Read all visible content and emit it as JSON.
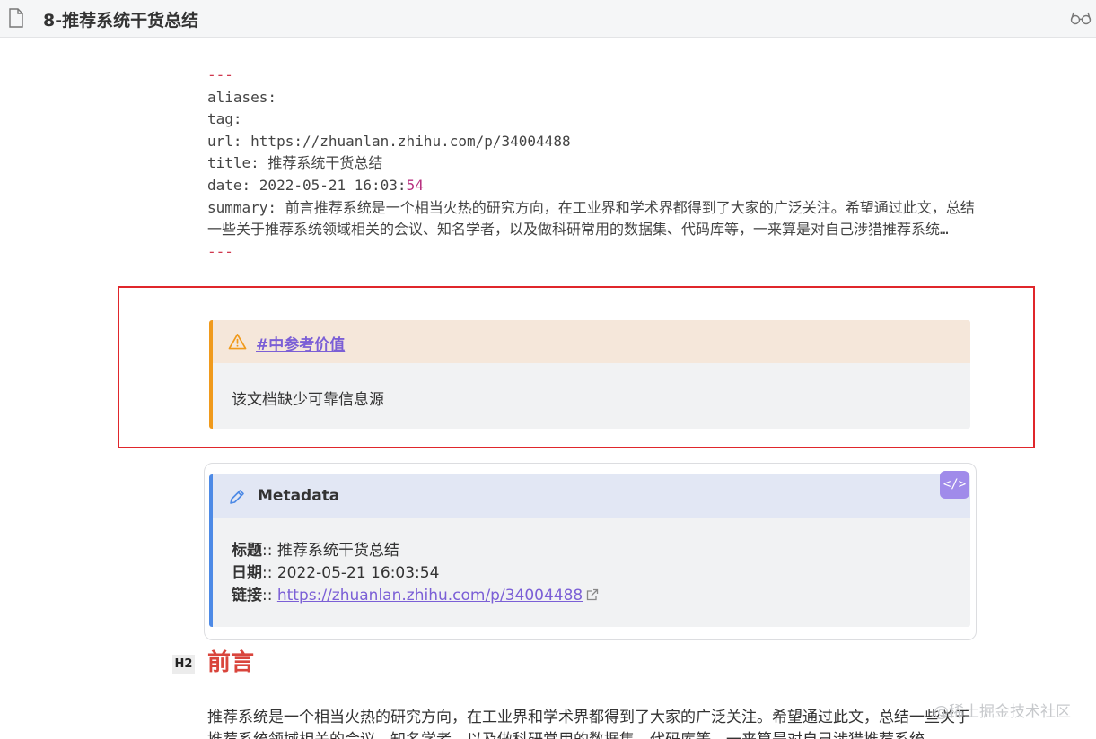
{
  "header": {
    "title": "8-推荐系统干货总结",
    "file_icon": "file-icon",
    "reading_icon": "glasses-icon"
  },
  "frontmatter": {
    "open_delimiter": "---",
    "aliases_line": "aliases:",
    "tag_line": "tag:",
    "url_line": "url: https://zhuanlan.zhihu.com/p/34004488",
    "title_line": "title: 推荐系统干货总结",
    "date_prefix": "date: 2022-05-21 16:03:",
    "date_seconds": "54",
    "summary_line": "summary: 前言推荐系统是一个相当火热的研究方向，在工业界和学术界都得到了大家的广泛关注。希望通过此文，总结一些关于推荐系统领域相关的会议、知名学者，以及做科研常用的数据集、代码库等，一来算是对自己涉猎推荐系统…",
    "close_delimiter": "---"
  },
  "warning_callout": {
    "icon": "warning-icon",
    "title": "#中参考价值",
    "body": "该文档缺少可靠信息源",
    "accent_color": "#f09a1c"
  },
  "metadata_callout": {
    "icon": "pencil-icon",
    "title": "Metadata",
    "code_button_label": "</>",
    "accent_color": "#4d8ae6",
    "rows": [
      {
        "key": "标题",
        "sep": ":: ",
        "value": "推荐系统干货总结"
      },
      {
        "key": "日期",
        "sep": ":: ",
        "value": "2022-05-21 16:03:54"
      },
      {
        "key": "链接",
        "sep": ":: ",
        "value": "https://zhuanlan.zhihu.com/p/34004488"
      }
    ]
  },
  "section": {
    "badge": "H2",
    "heading": "前言",
    "paragraph": "推荐系统是一个相当火热的研究方向，在工业界和学术界都得到了大家的广泛关注。希望通过此文，总结一些关于推荐系统领域相关的会议、知名学者，以及做科研常用的数据集、代码库等，一来算是对自己涉猎推荐系统..."
  },
  "watermark": "@稀土掘金技术社区"
}
